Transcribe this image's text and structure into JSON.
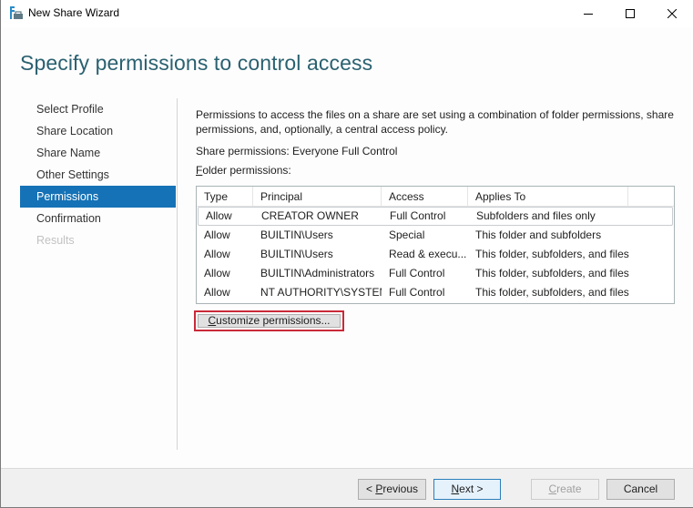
{
  "window": {
    "title": "New Share Wizard",
    "controls": {
      "minimize": "minimize",
      "maximize": "maximize",
      "close": "close"
    }
  },
  "page": {
    "title": "Specify permissions to control access"
  },
  "nav": {
    "items": [
      {
        "label": "Select Profile",
        "state": "normal"
      },
      {
        "label": "Share Location",
        "state": "normal"
      },
      {
        "label": "Share Name",
        "state": "normal"
      },
      {
        "label": "Other Settings",
        "state": "normal"
      },
      {
        "label": "Permissions",
        "state": "active"
      },
      {
        "label": "Confirmation",
        "state": "normal"
      },
      {
        "label": "Results",
        "state": "disabled"
      }
    ]
  },
  "content": {
    "description": "Permissions to access the files on a share are set using a combination of folder permissions, share permissions, and, optionally, a central access policy.",
    "share_permissions": "Share permissions: Everyone Full Control",
    "folder_permissions_label": {
      "accel": "F",
      "rest": "older permissions:"
    }
  },
  "grid": {
    "columns": [
      "Type",
      "Principal",
      "Access",
      "Applies To"
    ],
    "rows": [
      {
        "type": "Allow",
        "principal": "CREATOR OWNER",
        "access": "Full Control",
        "applies_to": "Subfolders and files only",
        "selected": true
      },
      {
        "type": "Allow",
        "principal": "BUILTIN\\Users",
        "access": "Special",
        "applies_to": "This folder and subfolders"
      },
      {
        "type": "Allow",
        "principal": "BUILTIN\\Users",
        "access": "Read & execu...",
        "applies_to": "This folder, subfolders, and files"
      },
      {
        "type": "Allow",
        "principal": "BUILTIN\\Administrators",
        "access": "Full Control",
        "applies_to": "This folder, subfolders, and files"
      },
      {
        "type": "Allow",
        "principal": "NT AUTHORITY\\SYSTEM",
        "access": "Full Control",
        "applies_to": "This folder, subfolders, and files"
      }
    ]
  },
  "buttons": {
    "customize": {
      "accel": "C",
      "rest": "ustomize permissions..."
    },
    "previous": {
      "prefix": "< ",
      "accel": "P",
      "rest": "revious"
    },
    "next": {
      "accel": "N",
      "rest": "ext >"
    },
    "create": {
      "accel": "C",
      "rest": "reate",
      "enabled": false
    },
    "cancel": "Cancel"
  },
  "colors": {
    "accent": "#1572b6",
    "title": "#2a6170",
    "highlight_border": "#c92a39"
  }
}
